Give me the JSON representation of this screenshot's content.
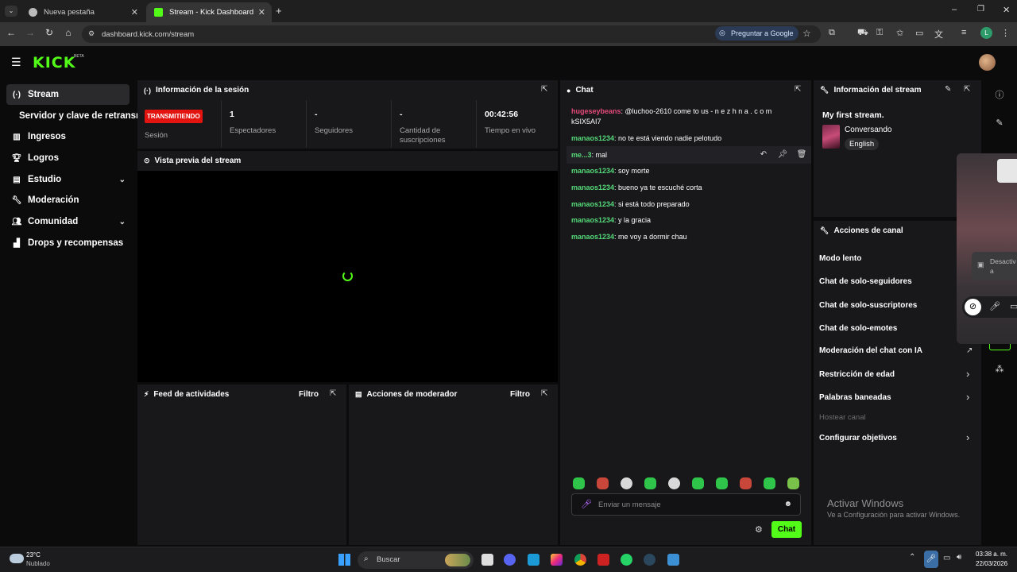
{
  "browser": {
    "tabs": [
      {
        "label": "Nueva pestaña"
      },
      {
        "label": "Stream - Kick Dashboard"
      }
    ],
    "url": "dashboard.kick.com/stream",
    "google_button": "Preguntar a Google",
    "profile_initial": "L"
  },
  "kick": {
    "logo": "KICK",
    "beta": "BETA"
  },
  "sidebar": {
    "items": [
      {
        "label": "Stream",
        "icon": "broadcast-icon"
      },
      {
        "label": "Servidor y clave de retransm"
      },
      {
        "label": "Ingresos",
        "icon": "chart-icon"
      },
      {
        "label": "Logros",
        "icon": "trophy-icon"
      },
      {
        "label": "Estudio",
        "icon": "studio-icon"
      },
      {
        "label": "Moderación",
        "icon": "wrench-icon"
      },
      {
        "label": "Comunidad",
        "icon": "community-icon"
      },
      {
        "label": "Drops y recompensas",
        "icon": "drops-icon"
      }
    ]
  },
  "session": {
    "title": "Información de la sesión",
    "status_badge": "TRANSMITIENDO",
    "status_label": "Sesión",
    "stats": [
      {
        "value": "1",
        "label": "Espectadores"
      },
      {
        "value": "-",
        "label": "Seguidores"
      },
      {
        "value": "-",
        "label": "Cantidad de suscripciones"
      },
      {
        "value": "00:42:56",
        "label": "Tiempo en vivo"
      }
    ]
  },
  "preview": {
    "title": "Vista previa del stream"
  },
  "activity": {
    "title": "Feed de actividades",
    "filter": "Filtro"
  },
  "modactions": {
    "title": "Acciones de moderador",
    "filter": "Filtro"
  },
  "chat": {
    "title": "Chat",
    "messages": [
      {
        "user": "hugeseybeans",
        "text": ": @luchoo-2610 come to us - n e z h n a . c o m kSIX5AI7"
      },
      {
        "user": "manaos1234",
        "text": ": no te está viendo nadie pelotudo"
      },
      {
        "user": "me...3",
        "text": ": mal"
      },
      {
        "user": "manaos1234",
        "text": ": soy morte"
      },
      {
        "user": "manaos1234",
        "text": ": bueno ya te escuché corta"
      },
      {
        "user": "manaos1234",
        "text": ": si está todo preparado"
      },
      {
        "user": "manaos1234",
        "text": ": y la gracia"
      },
      {
        "user": "manaos1234",
        "text": ": me voy a dormir chau"
      }
    ],
    "input_placeholder": "Enviar un mensaje",
    "send_label": "Chat"
  },
  "stream_info": {
    "title": "Información del stream",
    "stream_title": "My first stream.",
    "category": "Conversando",
    "language": "English"
  },
  "channel_actions": {
    "title": "Acciones de canal",
    "items": [
      {
        "label": "Modo lento"
      },
      {
        "label": "Chat de solo-seguidores"
      },
      {
        "label": "Chat de solo-suscriptores"
      },
      {
        "label": "Chat de solo-emotes"
      },
      {
        "label": "Moderación del chat con IA"
      },
      {
        "label": "Restricción de edad"
      },
      {
        "label": "Palabras baneadas"
      },
      {
        "label": "Hostear canal"
      },
      {
        "label": "Configurar objetivos"
      }
    ]
  },
  "overlay": {
    "text": "Desactiv\na"
  },
  "watermark": {
    "line1": "Activar Windows",
    "line2": "Ve a Configuración para activar Windows."
  },
  "taskbar": {
    "weather_temp": "23°C",
    "weather_desc": "Nublado",
    "search": "Buscar",
    "time": "03:38 a. m.",
    "date": "22/03/2026"
  },
  "colors": {
    "accent": "#53fc18",
    "live": "#e3130f",
    "panel": "#18181a"
  }
}
